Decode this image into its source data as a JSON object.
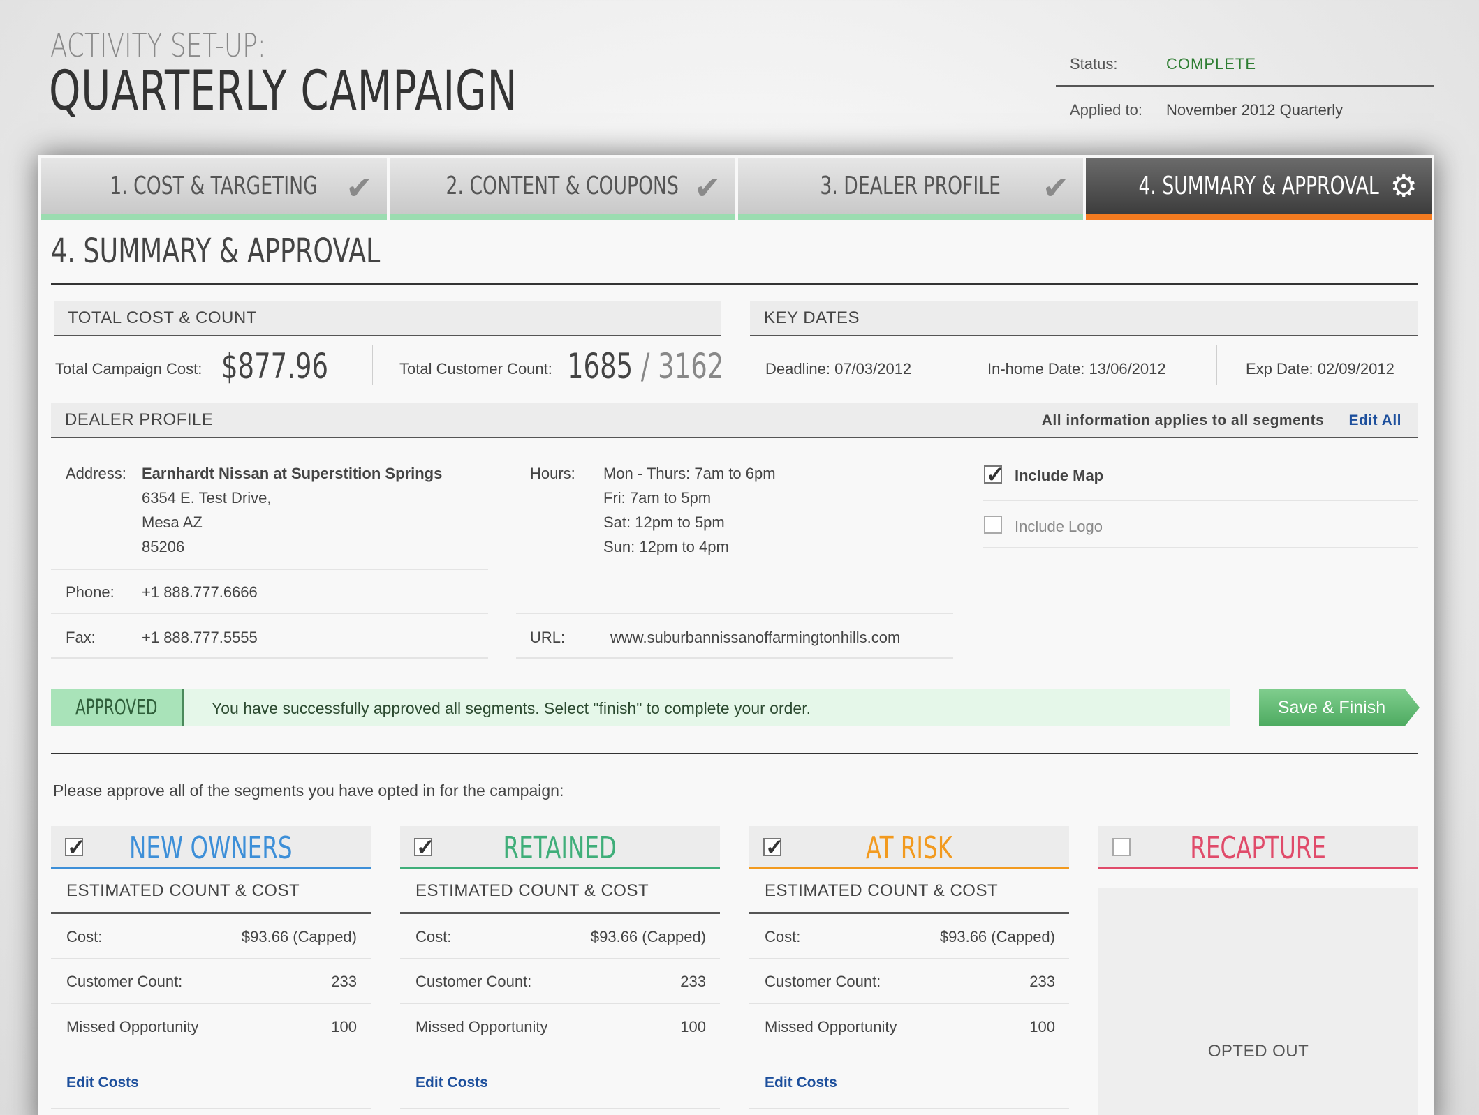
{
  "header": {
    "subtitle": "ACTIVITY SET-UP:",
    "title": "QUARTERLY CAMPAIGN",
    "status_label": "Status:",
    "status_value": "COMPLETE",
    "applied_label": "Applied to:",
    "applied_value": "November 2012 Quarterly"
  },
  "tabs": [
    {
      "label": "1. COST & TARGETING",
      "icon": "check-icon",
      "state": "complete"
    },
    {
      "label": "2. CONTENT & COUPONS",
      "icon": "check-icon",
      "state": "complete"
    },
    {
      "label": "3. DEALER PROFILE",
      "icon": "check-icon",
      "state": "complete"
    },
    {
      "label": "4. SUMMARY & APPROVAL",
      "icon": "gear-icon",
      "state": "active"
    }
  ],
  "section_title": "4. SUMMARY & APPROVAL",
  "cost": {
    "heading": "TOTAL COST & COUNT",
    "campaign_cost_label": "Total Campaign Cost:",
    "campaign_cost_value": "$877.96",
    "customer_count_label": "Total Customer Count:",
    "customer_count_value": "1685",
    "customer_count_separator": "/",
    "customer_count_total": "3162"
  },
  "key_dates": {
    "heading": "KEY DATES",
    "deadline": "Deadline: 07/03/2012",
    "in_home": "In-home Date: 13/06/2012",
    "exp": "Exp Date: 02/09/2012"
  },
  "dealer": {
    "heading": "DEALER PROFILE",
    "note": "All information applies to all segments",
    "edit_all": "Edit All",
    "address_label": "Address:",
    "address_name": "Earnhardt Nissan at Superstition Springs",
    "address_line1": "6354 E. Test Drive,",
    "address_line2": "Mesa AZ",
    "address_line3": "85206",
    "hours_label": "Hours:",
    "hours": [
      "Mon - Thurs: 7am to 6pm",
      "Fri: 7am to 5pm",
      "Sat: 12pm to 5pm",
      "Sun: 12pm to 4pm"
    ],
    "phone_label": "Phone:",
    "phone": "+1 888.777.6666",
    "fax_label": "Fax:",
    "fax": "+1 888.777.5555",
    "url_label": "URL:",
    "url": "www.suburbannissanoffarmingtonhills.com",
    "include_map": "Include Map",
    "include_map_checked": true,
    "include_logo": "Include Logo",
    "include_logo_checked": false
  },
  "approval": {
    "tag": "APPROVED",
    "message": "You have successfully approved all segments. Select \"finish\" to complete your order.",
    "save_button": "Save & Finish"
  },
  "segments_intro": "Please approve all of the segments you have opted in for the campaign:",
  "segments": [
    {
      "title": "NEW OWNERS",
      "color": "#3d8fd8",
      "checked": true,
      "sub": "ESTIMATED COUNT & COST",
      "cost_label": "Cost:",
      "cost": "$93.66 (Capped)",
      "count_label": "Customer Count:",
      "count": "233",
      "missed_label": "Missed Opportunity",
      "missed": "100",
      "edit": "Edit Costs"
    },
    {
      "title": "RETAINED",
      "color": "#3fae79",
      "checked": true,
      "sub": "ESTIMATED COUNT & COST",
      "cost_label": "Cost:",
      "cost": "$93.66 (Capped)",
      "count_label": "Customer Count:",
      "count": "233",
      "missed_label": "Missed Opportunity",
      "missed": "100",
      "edit": "Edit Costs"
    },
    {
      "title": "AT RISK",
      "color": "#f29a1f",
      "checked": true,
      "sub": "ESTIMATED COUNT & COST",
      "cost_label": "Cost:",
      "cost": "$93.66 (Capped)",
      "count_label": "Customer Count:",
      "count": "233",
      "missed_label": "Missed Opportunity",
      "missed": "100",
      "edit": "Edit Costs"
    },
    {
      "title": "RECAPTURE",
      "color": "#e04b6a",
      "checked": false,
      "opted_out": "OPTED OUT"
    }
  ],
  "colors": {
    "accent_tab": "#f47b20",
    "complete_tab": "#9bdcb0",
    "approved": "#a9e3b9",
    "link": "#1d4f9c"
  }
}
